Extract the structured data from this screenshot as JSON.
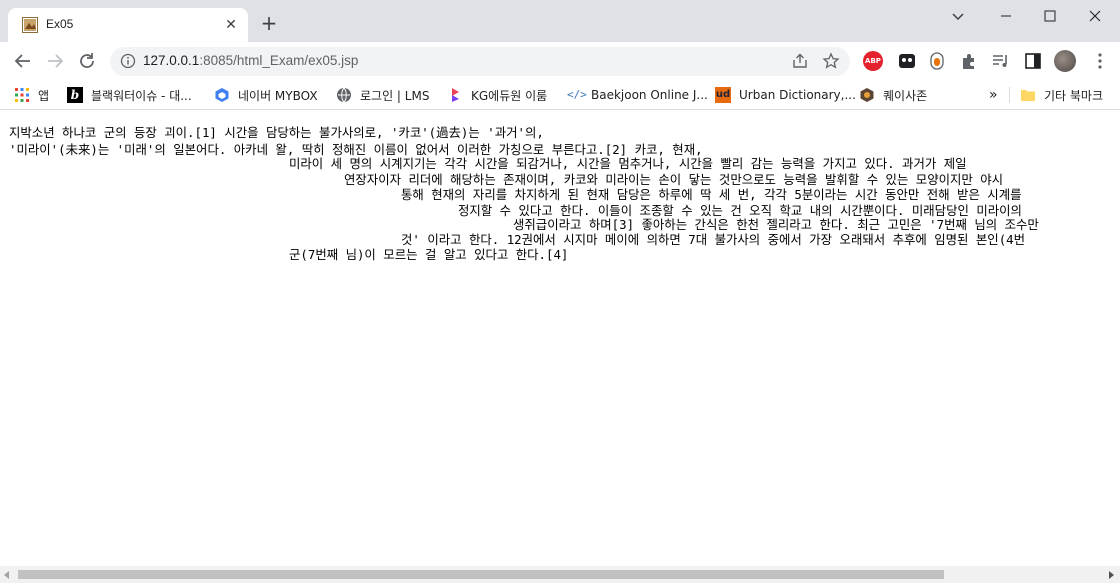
{
  "tab": {
    "title": "Ex05",
    "close_glyph": "✕",
    "new_tab_glyph": "+"
  },
  "window": {
    "dropdown_icon": "chevron-down-icon",
    "minimize_icon": "minimize-icon",
    "maximize_icon": "maximize-icon",
    "close_icon": "close-icon"
  },
  "toolbar": {
    "url_host": "127.0.0.1",
    "url_rest": ":8085/html_Exam/ex05.jsp",
    "abp_label": "ABP"
  },
  "bookmarks": [
    {
      "label": "앱",
      "icon": "apps-grid-icon"
    },
    {
      "label": "블랙워터이슈 - 대...",
      "icon": "b-logo-icon"
    },
    {
      "label": "네이버 MYBOX",
      "icon": "mybox-icon"
    },
    {
      "label": "로그인 | LMS",
      "icon": "globe-icon"
    },
    {
      "label": "KG에듀원 이룸",
      "icon": "kg-logo-icon"
    },
    {
      "label": "Baekjoon Online J...",
      "icon": "code-icon"
    },
    {
      "label": "Urban Dictionary,...",
      "icon": "ud-logo-icon"
    },
    {
      "label": "퀘이사존",
      "icon": "quasarzone-icon"
    },
    {
      "label": "»",
      "icon": "more-bookmarks-icon"
    },
    {
      "label": "기타 북마크",
      "icon": "folder-icon"
    }
  ],
  "content": {
    "lines": [
      "지박소년 하나코 군의 등장 괴이.[1] 시간을 담당하는 불가사의로, '카코'(過去)는 '과거'의,",
      "'미라이'(未来)는 '미래'의 일본어다. 아카네 왈, 딱히 정해진 이름이 없어서 이러한 가칭으로 부른다고.[2] 카코, 현재,",
      "미라이 세 명의 시계지기는 각각 시간을 되감거나, 시간을 멈추거나, 시간을 빨리 감는 능력을 가지고 있다. 과거가 제일",
      "연장자이자 리더에 해당하는 존재이며, 카코와 미라이는 손이 닿는 것만으로도 능력을 발휘할 수 있는 모양이지만 야시",
      "통해 현재의 자리를 차지하게 된 현재 담당은 하루에 딱 세 번, 각각 5분이라는 시간 동안만 전해 받은 시계를",
      "정지할 수 있다고 한다. 이들이 조종할 수 있는 건 오직 학교 내의 시간뿐이다. 미래담당인 미라이의",
      "생쥐급이라고 하며[3] 좋아하는 간식은 한천 젤리라고 한다. 최근 고민은 '7번째 님의 조수만",
      "것' 이라고 한다. 12권에서 시지마 메이에 의하면 7대 불가사의 중에서 가장 오래돼서 추후에 임명된 본인(4번",
      "군(7번째 님)이 모르는 걸 알고 있다고 한다.[4]"
    ]
  },
  "scrollbar": {
    "left_arrow": "◀",
    "right_arrow": "▶"
  }
}
